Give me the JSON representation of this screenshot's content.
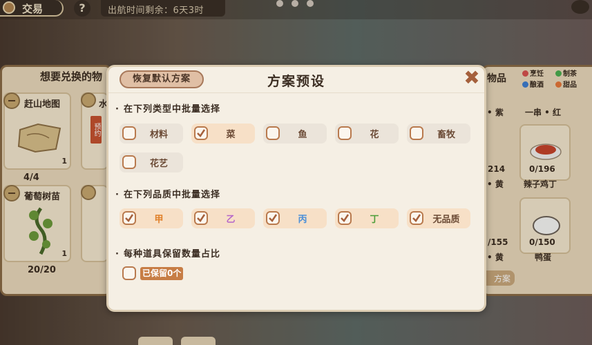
{
  "topbar": {
    "trade_label": "交易",
    "help": "?",
    "departure": "出航时间剩余：6天3时"
  },
  "left_panel": {
    "title": "想要兑换的物",
    "cards": [
      {
        "name": "赶山地图",
        "qty": "1",
        "count": "4/4"
      },
      {
        "name": "葡萄树苗",
        "qty": "1",
        "count": "20/20"
      }
    ],
    "partial_labels": [
      "水",
      "预约"
    ]
  },
  "right_panel": {
    "title": "物品",
    "legend": [
      {
        "label": "烹饪",
        "color": "#d9534f"
      },
      {
        "label": "制茶",
        "color": "#4caf50"
      },
      {
        "label": "酿酒",
        "color": "#3f7fd1"
      },
      {
        "label": "甜品",
        "color": "#e8783a"
      }
    ],
    "row1": [
      "• 紫",
      "一串 • 红"
    ],
    "row2_counts": [
      "214",
      "0/196"
    ],
    "row2_names": [
      "• 黄",
      "辣子鸡丁"
    ],
    "row3_counts": [
      "/155",
      "0/150"
    ],
    "row3_names": [
      "• 黄",
      "鸭蛋"
    ],
    "plan_button": "方案"
  },
  "modal": {
    "reset_button": "恢复默认方案",
    "title": "方案预设",
    "close_icon": "close-x-icon",
    "section_type": "在下列类型中批量选择",
    "types": [
      {
        "label": "材料",
        "checked": false
      },
      {
        "label": "菜",
        "checked": true
      },
      {
        "label": "鱼",
        "checked": false
      },
      {
        "label": "花",
        "checked": false
      },
      {
        "label": "畜牧",
        "checked": false
      },
      {
        "label": "花艺",
        "checked": false
      }
    ],
    "section_quality": "在下列品质中批量选择",
    "qualities": [
      {
        "label": "甲",
        "checked": true,
        "color": "#e0802a"
      },
      {
        "label": "乙",
        "checked": true,
        "color": "#b565c9"
      },
      {
        "label": "丙",
        "checked": true,
        "color": "#4a8fd8"
      },
      {
        "label": "丁",
        "checked": true,
        "color": "#4d9e3a"
      },
      {
        "label": "无品质",
        "checked": true,
        "color": "#6b4a35"
      }
    ],
    "section_retain": "每种道具保留数量占比",
    "retain_checked": false,
    "retain_tag": "已保留0个"
  },
  "colors": {
    "modal_bg": "#f5efe4",
    "accent": "#b97a4e",
    "tag": "#c77d45"
  }
}
